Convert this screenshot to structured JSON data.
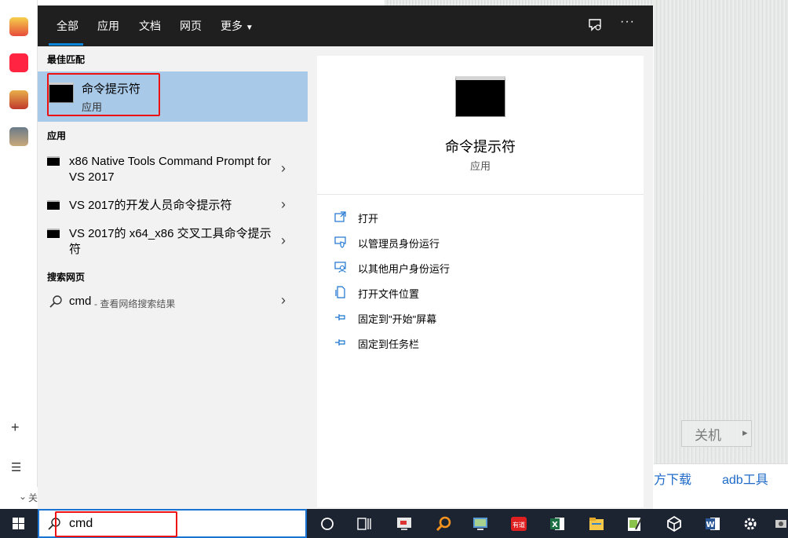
{
  "background": {
    "shutdown_label": "关机",
    "link_download": "方下载",
    "link_adb": "adb工具",
    "bottom_left_text": "关"
  },
  "tabs": [
    {
      "label": "全部",
      "active": true
    },
    {
      "label": "应用"
    },
    {
      "label": "文档"
    },
    {
      "label": "网页"
    },
    {
      "label": "更多"
    }
  ],
  "sections": {
    "best_match": "最佳匹配",
    "apps": "应用",
    "web": "搜索网页"
  },
  "best_match": {
    "name": "命令提示符",
    "type": "应用"
  },
  "apps": [
    {
      "name": "x86 Native Tools Command Prompt for VS 2017"
    },
    {
      "name": "VS 2017的开发人员命令提示符"
    },
    {
      "name": "VS 2017的 x64_x86 交叉工具命令提示符"
    }
  ],
  "web_result": {
    "query": "cmd",
    "hint": " - 查看网络搜索结果"
  },
  "detail": {
    "name": "命令提示符",
    "type": "应用",
    "actions": [
      {
        "label": "打开",
        "icon": "open-icon"
      },
      {
        "label": "以管理员身份运行",
        "icon": "shield-admin-icon"
      },
      {
        "label": "以其他用户身份运行",
        "icon": "user-run-icon"
      },
      {
        "label": "打开文件位置",
        "icon": "file-location-icon"
      },
      {
        "label": "固定到\"开始\"屏幕",
        "icon": "pin-icon"
      },
      {
        "label": "固定到任务栏",
        "icon": "pin-icon"
      }
    ]
  },
  "search": {
    "value": "cmd"
  },
  "taskbar_icons": [
    "task-view-icon",
    "timeline-icon",
    "screen-app-icon",
    "search-tool-icon",
    "remote-desktop-icon",
    "youdao-icon",
    "excel-icon",
    "file-explorer-icon",
    "notepad-icon",
    "unity-icon",
    "word-icon",
    "settings-icon",
    "app-icon"
  ],
  "colors": {
    "accent": "#0a84d8",
    "selected_row": "#a9c9e8",
    "highlight_box": "#e11111",
    "taskbar": "#1c2331"
  }
}
